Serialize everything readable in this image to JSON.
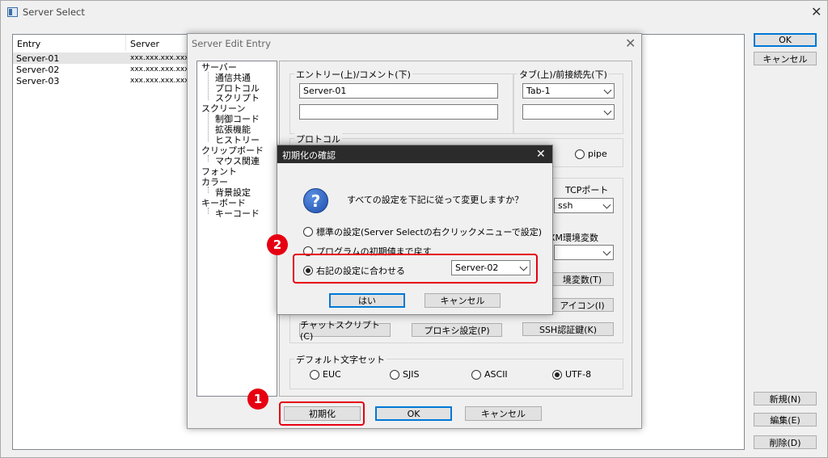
{
  "main_window": {
    "title": "Server Select",
    "columns": [
      "Entry",
      "Server"
    ],
    "rows": [
      {
        "entry": "Server-01",
        "server": "xxx.xxx.xxx.xxx"
      },
      {
        "entry": "Server-02",
        "server": "xxx.xxx.xxx.xxx"
      },
      {
        "entry": "Server-03",
        "server": "xxx.xxx.xxx.xxx"
      }
    ],
    "ok_label": "OK",
    "cancel_label": "キャンセル",
    "new_label": "新規(N)",
    "edit_label": "編集(E)",
    "delete_label": "削除(D)"
  },
  "edit_dialog": {
    "title": "Server Edit Entry",
    "tree": [
      "サーバー",
      "通信共通",
      "プロトコル",
      "スクリプト",
      "スクリーン",
      "制御コード",
      "拡張機能",
      "ヒストリー",
      "クリップボード",
      "マウス関連",
      "フォント",
      "カラー",
      "背景設定",
      "キーボード",
      "キーコード"
    ],
    "entry_group_label": "エントリー(上)/コメント(下)",
    "entry_value": "Server-01",
    "comment_value": "",
    "tab_group_label": "タブ(上)/前接続先(下)",
    "tab_value": "Tab-1",
    "prev_value": "",
    "protocol_label": "プロトコル",
    "pipe_label": "pipe",
    "tcp_port_label": "TCPポート",
    "tcp_port_value": "ssh",
    "env_label": "XM環境変数",
    "env_button_label": "境変数(T)",
    "icon_button_label": "アイコン(I)",
    "chat_script_label": "チャットスクリプト(C)",
    "proxy_label": "プロキシ設定(P)",
    "ssh_auth_label": "SSH認証鍵(K)",
    "charset_group_label": "デフォルト文字セット",
    "charsets": [
      "EUC",
      "SJIS",
      "ASCII",
      "UTF-8"
    ],
    "init_label": "初期化",
    "ok_label": "OK",
    "cancel_label": "キャンセル"
  },
  "confirm_dialog": {
    "title": "初期化の確認",
    "message": "すべての設定を下記に従って変更しますか？",
    "option1": "標準の設定(Server Selectの右クリックメニューで設定)",
    "option2": "プログラムの初期値まで戻す",
    "option3": "右記の設定に合わせる",
    "select_value": "Server-02",
    "yes_label": "はい",
    "cancel_label": "キャンセル"
  },
  "markers": [
    "1",
    "2"
  ],
  "colors": {
    "highlight": "#e60012",
    "accent": "#0078d7",
    "dialog_bg": "#f0f0f0"
  }
}
